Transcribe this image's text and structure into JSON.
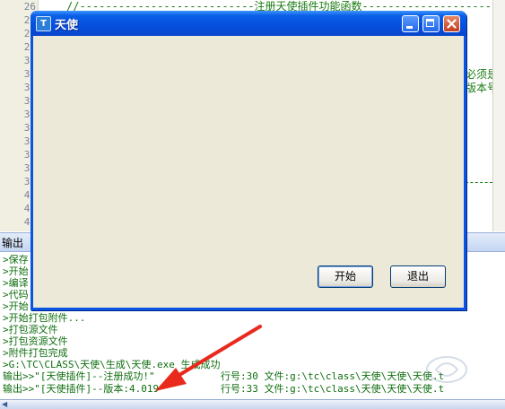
{
  "editor": {
    "line_numbers": [
      "26",
      "27",
      "28",
      "29",
      "30",
      "31",
      "32",
      "33",
      "34",
      "35",
      "36",
      "37",
      "38",
      "39",
      "40",
      "41",
      "42"
    ],
    "code_top": "//---------------------------注册天使插件功能函数----------------------",
    "code_right_1": "必须是“",
    "code_right_2": "版本号”"
  },
  "output": {
    "title": "输出",
    "lines": [
      {
        "text": ">保存"
      },
      {
        "text": ">开始"
      },
      {
        "text": ">编译"
      },
      {
        "text": ">代码"
      },
      {
        "text": ">开始"
      },
      {
        "text": ">开始打包附件..."
      },
      {
        "text": ">打包源文件"
      },
      {
        "text": ">打包资源文件"
      },
      {
        "text": ">附件打包完成"
      },
      {
        "text": ">G:\\TC\\CLASS\\天使\\生成\\天使.exe 生成成功"
      },
      {
        "text": "输出>>\"[天使插件]--注册成功!\"",
        "rest": "行号:30 文件:g:\\tc\\class\\天使\\天使\\天使.t"
      },
      {
        "text": "输出>>\"[天使插件]--版本:4.019\"",
        "rest": "行号:33 文件:g:\\tc\\class\\天使\\天使\\天使.t"
      }
    ]
  },
  "dialog": {
    "title": "天使",
    "icon_letter": "T",
    "start_label": "开始",
    "quit_label": "退出"
  },
  "colors": {
    "annotation_arrow": "#e8291c",
    "output_text": "#0f6e0f",
    "xp_title_blue": "#0650de"
  },
  "icons": {
    "app": "angel-app-icon",
    "minimize": "minimize-icon",
    "maximize": "maximize-icon",
    "close": "close-icon"
  }
}
